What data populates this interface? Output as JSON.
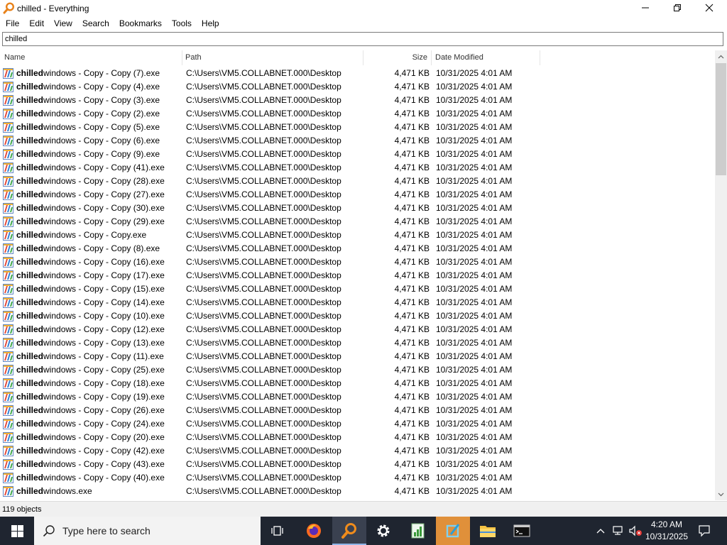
{
  "window": {
    "title": "chilled - Everything"
  },
  "menu": [
    "File",
    "Edit",
    "View",
    "Search",
    "Bookmarks",
    "Tools",
    "Help"
  ],
  "search": {
    "value": "chilled"
  },
  "columns": {
    "name": "Name",
    "path": "Path",
    "size": "Size",
    "date": "Date Modified"
  },
  "query_highlight": "chilled",
  "rows": [
    {
      "name_rest": "windows - Copy - Copy (7).exe",
      "path": "C:\\Users\\VM5.COLLABNET.000\\Desktop",
      "size": "4,471 KB",
      "date": "10/31/2025 4:01 AM"
    },
    {
      "name_rest": "windows - Copy - Copy (4).exe",
      "path": "C:\\Users\\VM5.COLLABNET.000\\Desktop",
      "size": "4,471 KB",
      "date": "10/31/2025 4:01 AM"
    },
    {
      "name_rest": "windows - Copy - Copy (3).exe",
      "path": "C:\\Users\\VM5.COLLABNET.000\\Desktop",
      "size": "4,471 KB",
      "date": "10/31/2025 4:01 AM"
    },
    {
      "name_rest": "windows - Copy - Copy (2).exe",
      "path": "C:\\Users\\VM5.COLLABNET.000\\Desktop",
      "size": "4,471 KB",
      "date": "10/31/2025 4:01 AM"
    },
    {
      "name_rest": "windows - Copy - Copy (5).exe",
      "path": "C:\\Users\\VM5.COLLABNET.000\\Desktop",
      "size": "4,471 KB",
      "date": "10/31/2025 4:01 AM"
    },
    {
      "name_rest": "windows - Copy - Copy (6).exe",
      "path": "C:\\Users\\VM5.COLLABNET.000\\Desktop",
      "size": "4,471 KB",
      "date": "10/31/2025 4:01 AM"
    },
    {
      "name_rest": "windows - Copy - Copy (9).exe",
      "path": "C:\\Users\\VM5.COLLABNET.000\\Desktop",
      "size": "4,471 KB",
      "date": "10/31/2025 4:01 AM"
    },
    {
      "name_rest": "windows - Copy - Copy (41).exe",
      "path": "C:\\Users\\VM5.COLLABNET.000\\Desktop",
      "size": "4,471 KB",
      "date": "10/31/2025 4:01 AM"
    },
    {
      "name_rest": "windows - Copy - Copy (28).exe",
      "path": "C:\\Users\\VM5.COLLABNET.000\\Desktop",
      "size": "4,471 KB",
      "date": "10/31/2025 4:01 AM"
    },
    {
      "name_rest": "windows - Copy - Copy (27).exe",
      "path": "C:\\Users\\VM5.COLLABNET.000\\Desktop",
      "size": "4,471 KB",
      "date": "10/31/2025 4:01 AM"
    },
    {
      "name_rest": "windows - Copy - Copy (30).exe",
      "path": "C:\\Users\\VM5.COLLABNET.000\\Desktop",
      "size": "4,471 KB",
      "date": "10/31/2025 4:01 AM"
    },
    {
      "name_rest": "windows - Copy - Copy (29).exe",
      "path": "C:\\Users\\VM5.COLLABNET.000\\Desktop",
      "size": "4,471 KB",
      "date": "10/31/2025 4:01 AM"
    },
    {
      "name_rest": "windows - Copy - Copy.exe",
      "path": "C:\\Users\\VM5.COLLABNET.000\\Desktop",
      "size": "4,471 KB",
      "date": "10/31/2025 4:01 AM"
    },
    {
      "name_rest": "windows - Copy - Copy (8).exe",
      "path": "C:\\Users\\VM5.COLLABNET.000\\Desktop",
      "size": "4,471 KB",
      "date": "10/31/2025 4:01 AM"
    },
    {
      "name_rest": "windows - Copy - Copy (16).exe",
      "path": "C:\\Users\\VM5.COLLABNET.000\\Desktop",
      "size": "4,471 KB",
      "date": "10/31/2025 4:01 AM"
    },
    {
      "name_rest": "windows - Copy - Copy (17).exe",
      "path": "C:\\Users\\VM5.COLLABNET.000\\Desktop",
      "size": "4,471 KB",
      "date": "10/31/2025 4:01 AM"
    },
    {
      "name_rest": "windows - Copy - Copy (15).exe",
      "path": "C:\\Users\\VM5.COLLABNET.000\\Desktop",
      "size": "4,471 KB",
      "date": "10/31/2025 4:01 AM"
    },
    {
      "name_rest": "windows - Copy - Copy (14).exe",
      "path": "C:\\Users\\VM5.COLLABNET.000\\Desktop",
      "size": "4,471 KB",
      "date": "10/31/2025 4:01 AM"
    },
    {
      "name_rest": "windows - Copy - Copy (10).exe",
      "path": "C:\\Users\\VM5.COLLABNET.000\\Desktop",
      "size": "4,471 KB",
      "date": "10/31/2025 4:01 AM"
    },
    {
      "name_rest": "windows - Copy - Copy (12).exe",
      "path": "C:\\Users\\VM5.COLLABNET.000\\Desktop",
      "size": "4,471 KB",
      "date": "10/31/2025 4:01 AM"
    },
    {
      "name_rest": "windows - Copy - Copy (13).exe",
      "path": "C:\\Users\\VM5.COLLABNET.000\\Desktop",
      "size": "4,471 KB",
      "date": "10/31/2025 4:01 AM"
    },
    {
      "name_rest": "windows - Copy - Copy (11).exe",
      "path": "C:\\Users\\VM5.COLLABNET.000\\Desktop",
      "size": "4,471 KB",
      "date": "10/31/2025 4:01 AM"
    },
    {
      "name_rest": "windows - Copy - Copy (25).exe",
      "path": "C:\\Users\\VM5.COLLABNET.000\\Desktop",
      "size": "4,471 KB",
      "date": "10/31/2025 4:01 AM"
    },
    {
      "name_rest": "windows - Copy - Copy (18).exe",
      "path": "C:\\Users\\VM5.COLLABNET.000\\Desktop",
      "size": "4,471 KB",
      "date": "10/31/2025 4:01 AM"
    },
    {
      "name_rest": "windows - Copy - Copy (19).exe",
      "path": "C:\\Users\\VM5.COLLABNET.000\\Desktop",
      "size": "4,471 KB",
      "date": "10/31/2025 4:01 AM"
    },
    {
      "name_rest": "windows - Copy - Copy (26).exe",
      "path": "C:\\Users\\VM5.COLLABNET.000\\Desktop",
      "size": "4,471 KB",
      "date": "10/31/2025 4:01 AM"
    },
    {
      "name_rest": "windows - Copy - Copy (24).exe",
      "path": "C:\\Users\\VM5.COLLABNET.000\\Desktop",
      "size": "4,471 KB",
      "date": "10/31/2025 4:01 AM"
    },
    {
      "name_rest": "windows - Copy - Copy (20).exe",
      "path": "C:\\Users\\VM5.COLLABNET.000\\Desktop",
      "size": "4,471 KB",
      "date": "10/31/2025 4:01 AM"
    },
    {
      "name_rest": "windows - Copy - Copy (42).exe",
      "path": "C:\\Users\\VM5.COLLABNET.000\\Desktop",
      "size": "4,471 KB",
      "date": "10/31/2025 4:01 AM"
    },
    {
      "name_rest": "windows - Copy - Copy (43).exe",
      "path": "C:\\Users\\VM5.COLLABNET.000\\Desktop",
      "size": "4,471 KB",
      "date": "10/31/2025 4:01 AM"
    },
    {
      "name_rest": "windows - Copy - Copy (40).exe",
      "path": "C:\\Users\\VM5.COLLABNET.000\\Desktop",
      "size": "4,471 KB",
      "date": "10/31/2025 4:01 AM"
    },
    {
      "name_rest": "windows.exe",
      "path": "C:\\Users\\VM5.COLLABNET.000\\Desktop",
      "size": "4,471 KB",
      "date": "10/31/2025 4:01 AM"
    }
  ],
  "status": {
    "count": "119 objects"
  },
  "taskbar": {
    "search_placeholder": "Type here to search",
    "apps": [
      "task-view",
      "firefox",
      "everything",
      "settings",
      "notepad",
      "editor",
      "file-explorer",
      "command-prompt"
    ],
    "active_app": "everything",
    "clock_time": "4:20 AM",
    "clock_date": "10/31/2025"
  },
  "colors": {
    "taskbar_bg": "#1f2530",
    "active_app_bg": "#3a4150",
    "active_indicator": "#8fb5e8",
    "everything_orange": "#f08c1c"
  }
}
